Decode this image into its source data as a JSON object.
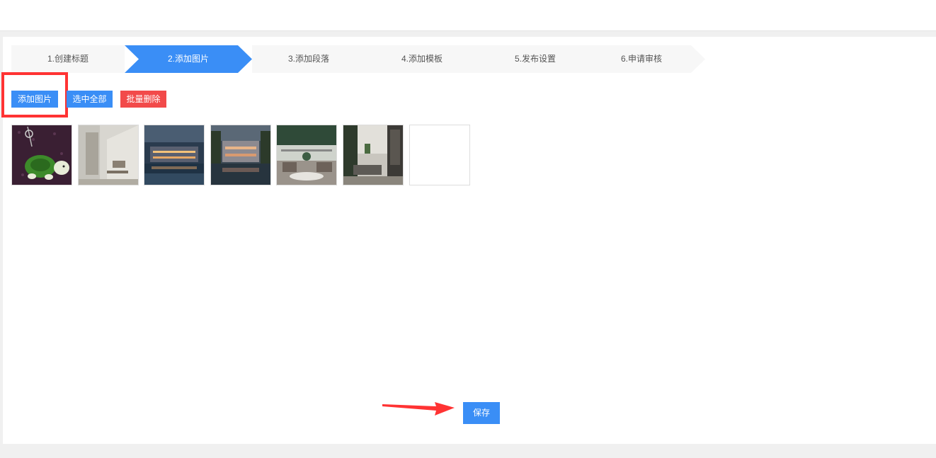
{
  "steps": [
    {
      "label": "1.创建标题"
    },
    {
      "label": "2.添加图片"
    },
    {
      "label": "3.添加段落"
    },
    {
      "label": "4.添加模板"
    },
    {
      "label": "5.发布设置"
    },
    {
      "label": "6.申请审核"
    }
  ],
  "active_step": 2,
  "toolbar": {
    "add_image_label": "添加图片",
    "select_all_label": "选中全部",
    "batch_delete_label": "批量删除"
  },
  "save_label": "保存",
  "colors": {
    "accent": "#3a8ef6",
    "danger": "#f24a4a",
    "highlight": "#ff3333"
  }
}
